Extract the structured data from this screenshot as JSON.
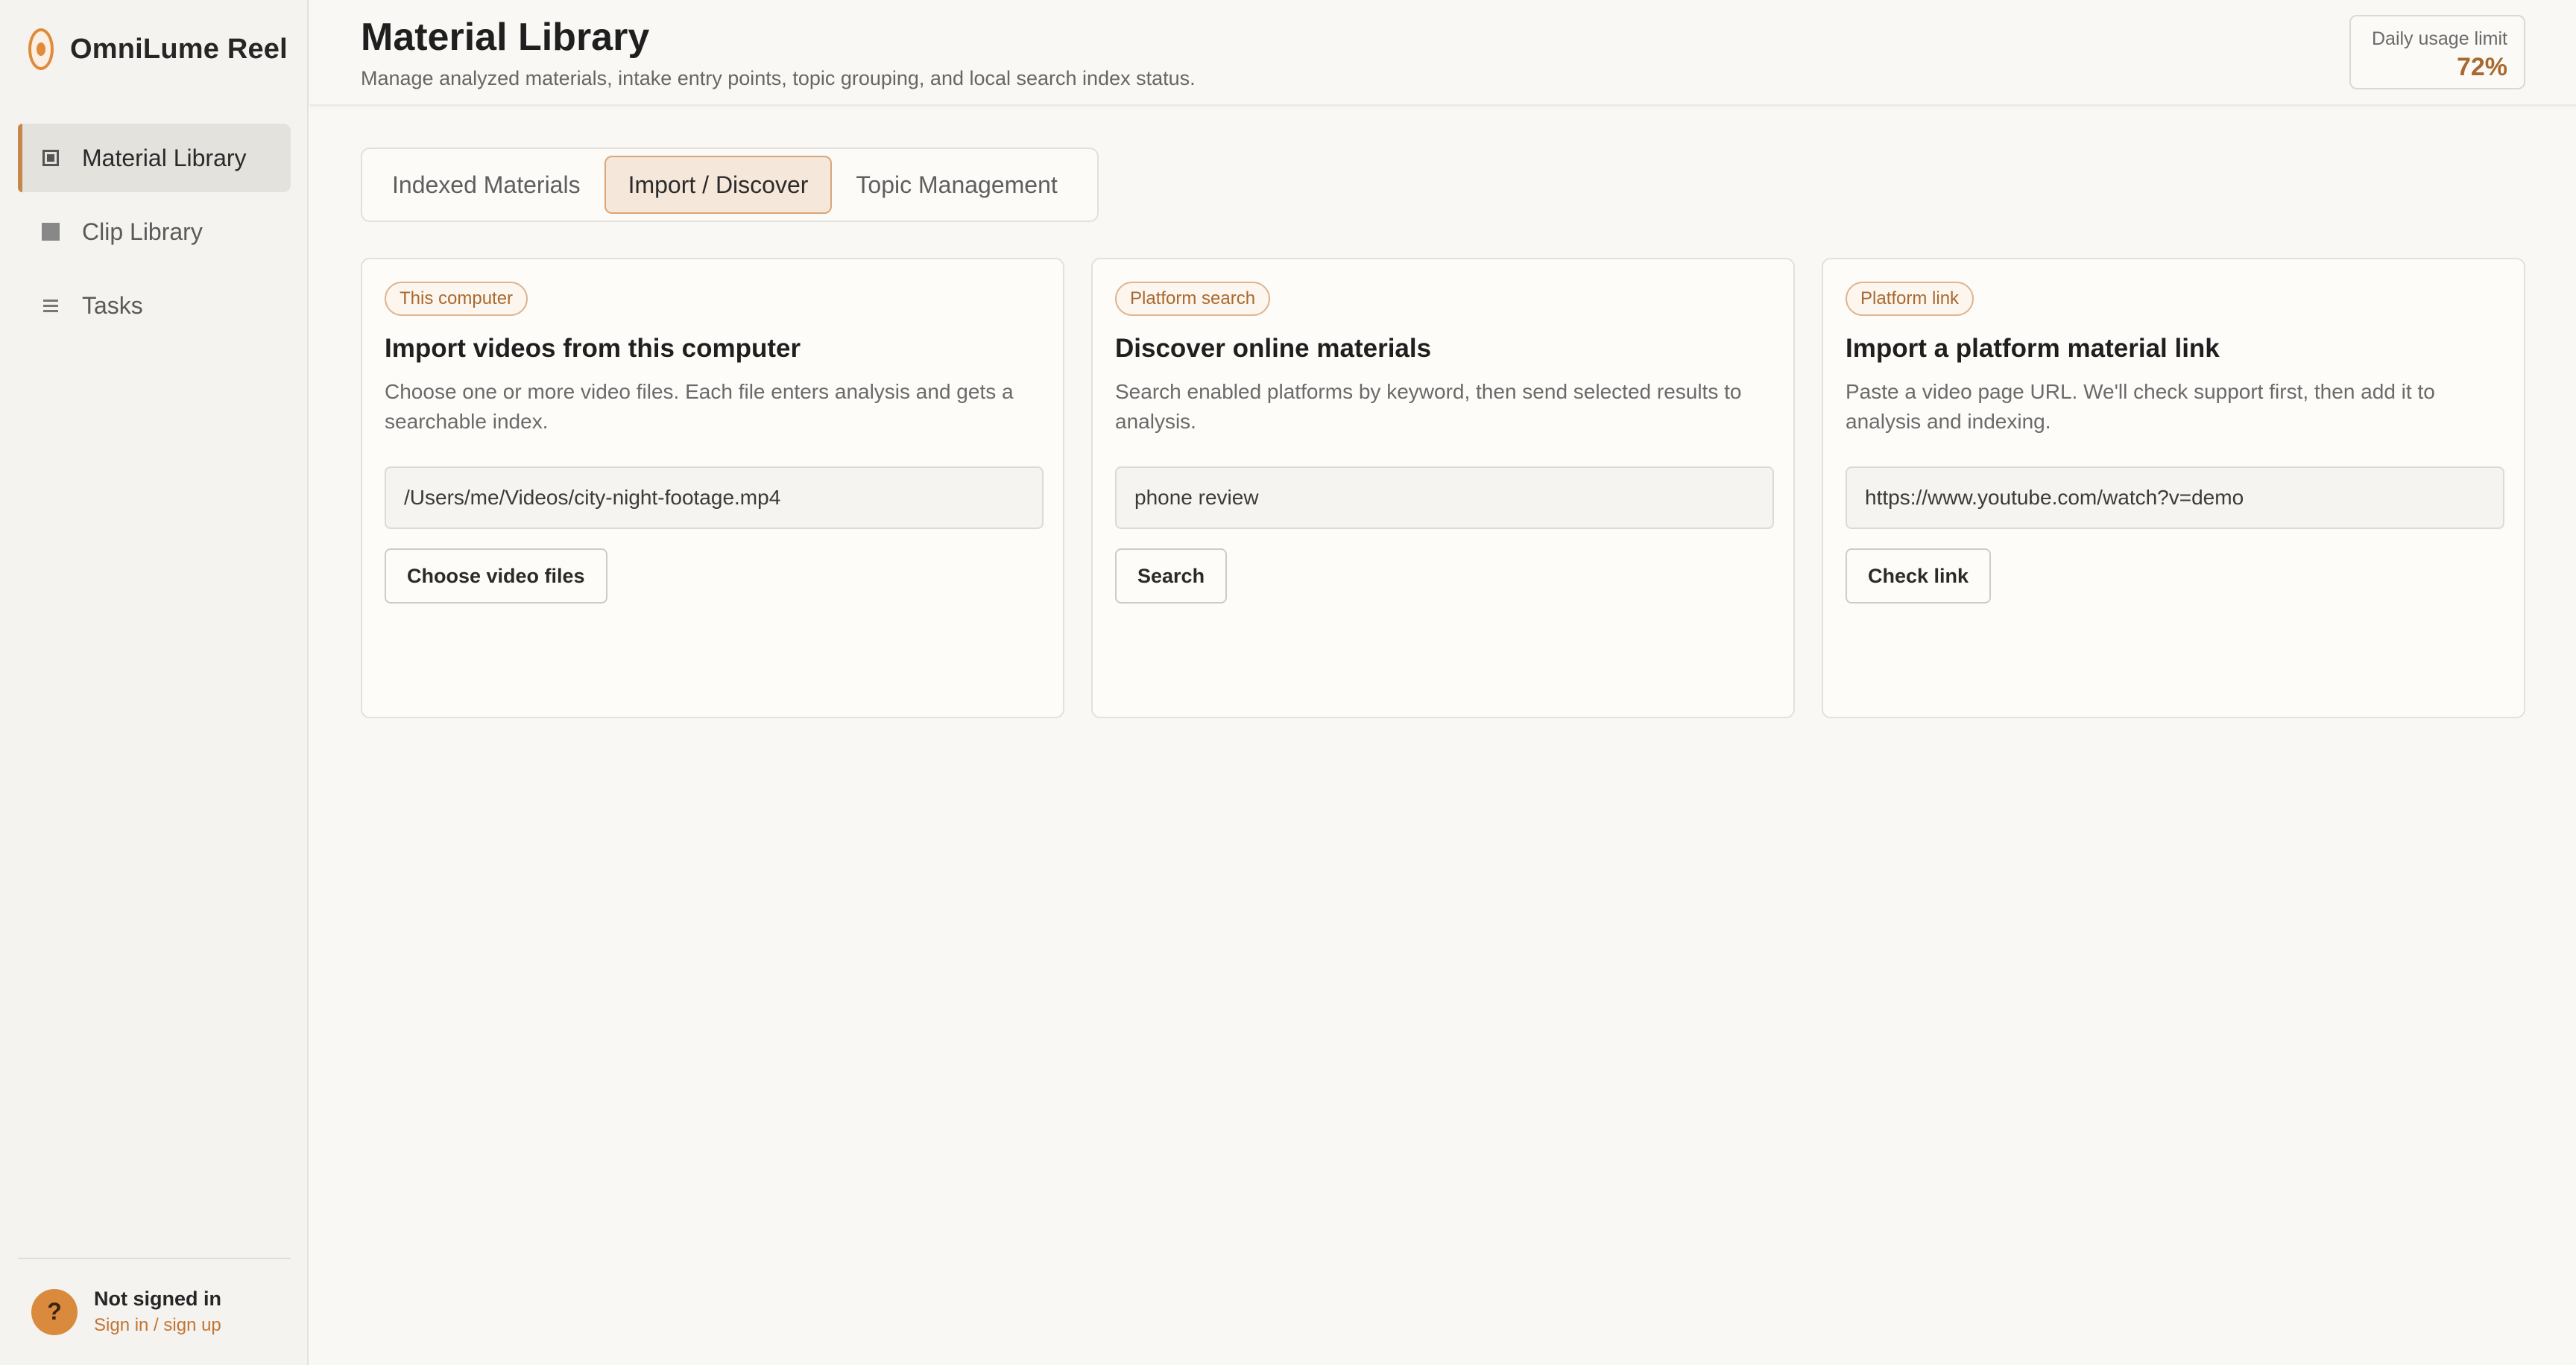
{
  "app": {
    "name": "OmniLume Reel"
  },
  "sidebar": {
    "items": [
      {
        "label": "Material Library",
        "icon": "square-outline-icon",
        "active": true
      },
      {
        "label": "Clip Library",
        "icon": "square-filled-icon",
        "active": false
      },
      {
        "label": "Tasks",
        "icon": "list-icon",
        "active": false
      }
    ],
    "user": {
      "avatar": "?",
      "status": "Not signed in",
      "link": "Sign in / sign up"
    }
  },
  "header": {
    "title": "Material Library",
    "subtitle": "Manage analyzed materials, intake entry points, topic grouping, and local search index status.",
    "usage": {
      "label": "Daily usage limit",
      "value": "72%"
    }
  },
  "tabs": [
    {
      "label": "Indexed Materials",
      "active": false
    },
    {
      "label": "Import / Discover",
      "active": true
    },
    {
      "label": "Topic Management",
      "active": false
    }
  ],
  "cards": [
    {
      "badge": "This computer",
      "title": "Import videos from this computer",
      "description": "Choose one or more video files. Each file enters analysis and gets a searchable index.",
      "input_value": "/Users/me/Videos/city-night-footage.mp4",
      "button": "Choose video files"
    },
    {
      "badge": "Platform search",
      "title": "Discover online materials",
      "description": "Search enabled platforms by keyword, then send selected results to analysis.",
      "input_value": "phone review",
      "button": "Search"
    },
    {
      "badge": "Platform link",
      "title": "Import a platform material link",
      "description": "Paste a video page URL. We'll check support first, then add it to analysis and indexing.",
      "input_value": "https://www.youtube.com/watch?v=demo",
      "button": "Check link"
    }
  ],
  "colors": {
    "accent": "#d98a3d",
    "accent_text": "#a8692f",
    "background": "#f9f8f5"
  }
}
